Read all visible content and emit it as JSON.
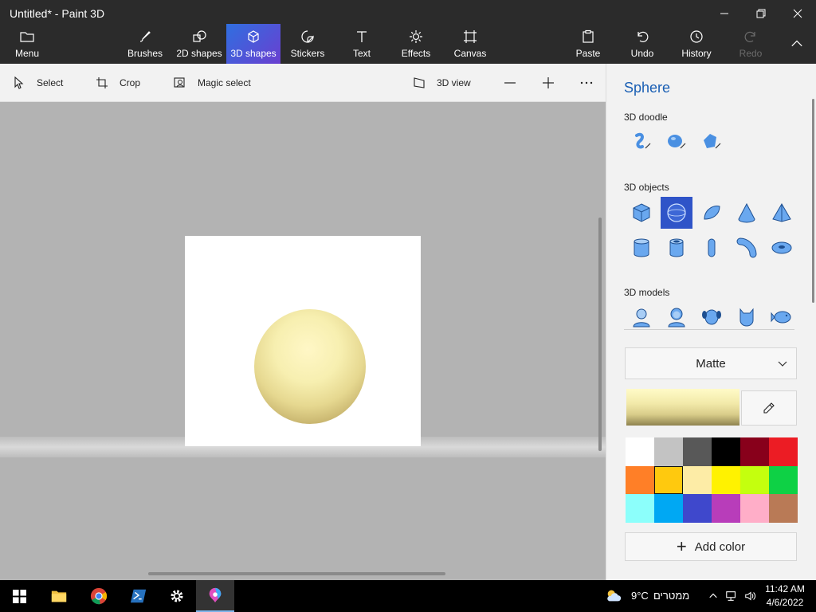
{
  "window": {
    "title": "Untitled* - Paint 3D"
  },
  "ribbon": {
    "menu": "Menu",
    "brushes": "Brushes",
    "shapes2d": "2D shapes",
    "shapes3d": "3D shapes",
    "stickers": "Stickers",
    "text": "Text",
    "effects": "Effects",
    "canvas": "Canvas",
    "paste": "Paste",
    "undo": "Undo",
    "history": "History",
    "redo": "Redo",
    "active_tab": "3D shapes"
  },
  "commandbar": {
    "select": "Select",
    "crop": "Crop",
    "magic_select": "Magic select",
    "view3d": "3D view"
  },
  "panel": {
    "title": "Sphere",
    "doodle_heading": "3D doodle",
    "objects_heading": "3D objects",
    "models_heading": "3D models",
    "selected_object": "sphere",
    "material": "Matte",
    "add_color": "Add color",
    "palette": [
      "#ffffff",
      "#c3c3c3",
      "#585858",
      "#000000",
      "#88001b",
      "#ec1c24",
      "#ff7f27",
      "#ffc90e",
      "#fdeca6",
      "#fff200",
      "#c4ff0e",
      "#0ed145",
      "#8cfffb",
      "#00a8f3",
      "#3f48cc",
      "#b83dba",
      "#ffaec8",
      "#b97a56"
    ],
    "selected_swatch_index": 7
  },
  "taskbar": {
    "weather": "9°C",
    "weather_text": "ממטרים",
    "time": "11:42 AM",
    "date": "4/6/2022"
  },
  "colors": {
    "accent": "#2f54c8",
    "titlebar": "#2b2b2b",
    "panel_bg": "#f2f2f2",
    "panel_title": "#1a5fb4"
  }
}
